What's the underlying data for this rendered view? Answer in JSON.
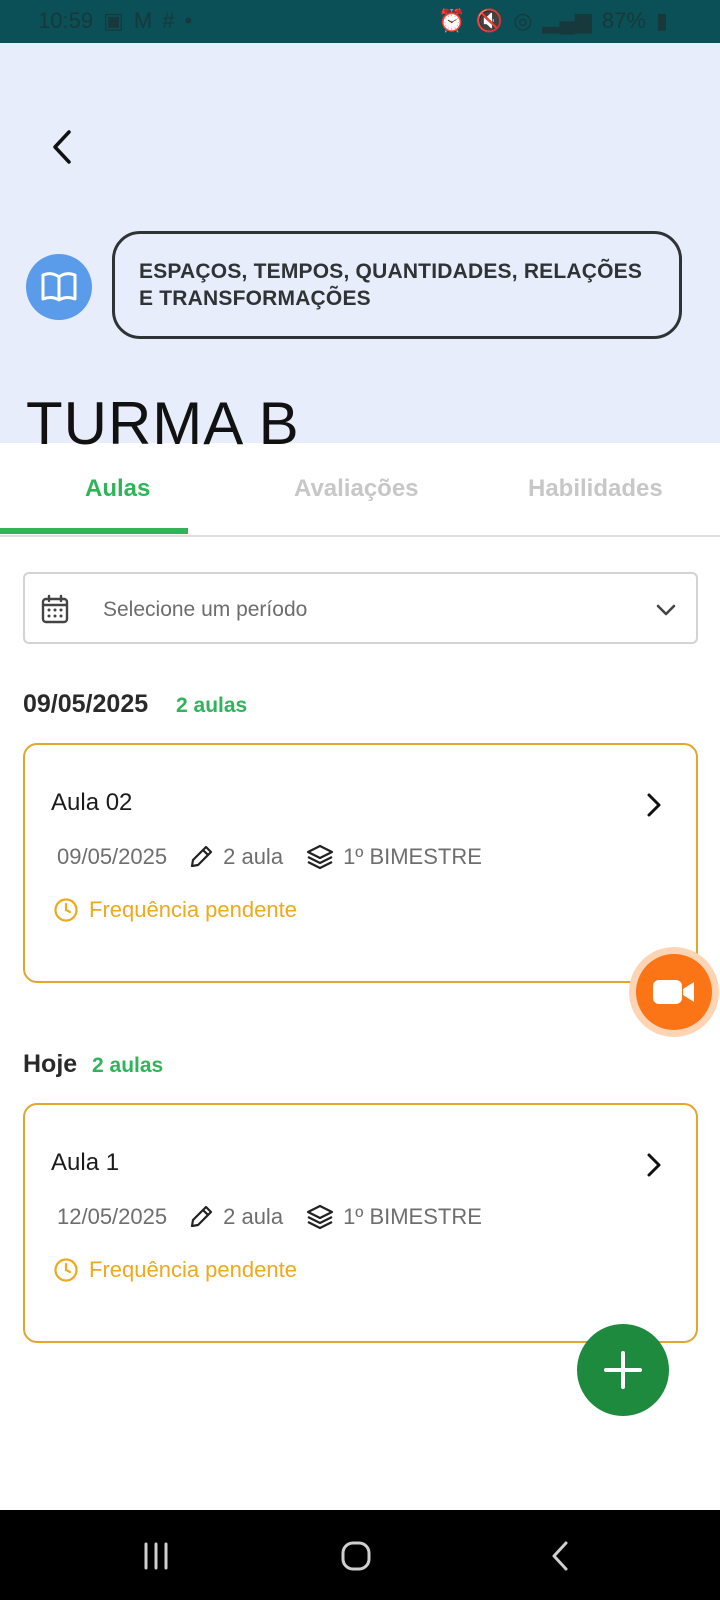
{
  "status_bar": {
    "time": "10:59",
    "left_icons": [
      "photo-icon",
      "mail-icon",
      "slack-icon",
      "dot-icon"
    ],
    "right_icons": [
      "alarm-icon",
      "mute-icon",
      "hotspot-icon",
      "signal-icon"
    ],
    "battery": "87%"
  },
  "header": {
    "subject": "ESPAÇOS, TEMPOS, QUANTIDADES, RELAÇÕES E TRANSFORMAÇÕES",
    "class_name": "TURMA B"
  },
  "tabs": [
    {
      "label": "Aulas",
      "active": true
    },
    {
      "label": "Avaliações",
      "active": false
    },
    {
      "label": "Habilidades",
      "active": false
    }
  ],
  "period_select": {
    "placeholder": "Selecione um período"
  },
  "groups": [
    {
      "title": "09/05/2025",
      "count": "2 aulas",
      "cards": [
        {
          "title": "Aula 02",
          "date": "09/05/2025",
          "lessons": "2 aula",
          "term": "1º BIMESTRE",
          "status": "Frequência pendente"
        }
      ]
    },
    {
      "title": "Hoje",
      "count": "2 aulas",
      "cards": [
        {
          "title": "Aula 1",
          "date": "12/05/2025",
          "lessons": "2 aula",
          "term": "1º BIMESTRE",
          "status": "Frequência pendente"
        }
      ]
    }
  ],
  "colors": {
    "accent_green": "#2fb45a",
    "fab_green": "#1d8a3d",
    "pending_orange": "#f0a81c",
    "video_orange": "#fb7416",
    "header_bg": "#e8edfb",
    "subject_icon_blue": "#5a9bea"
  }
}
